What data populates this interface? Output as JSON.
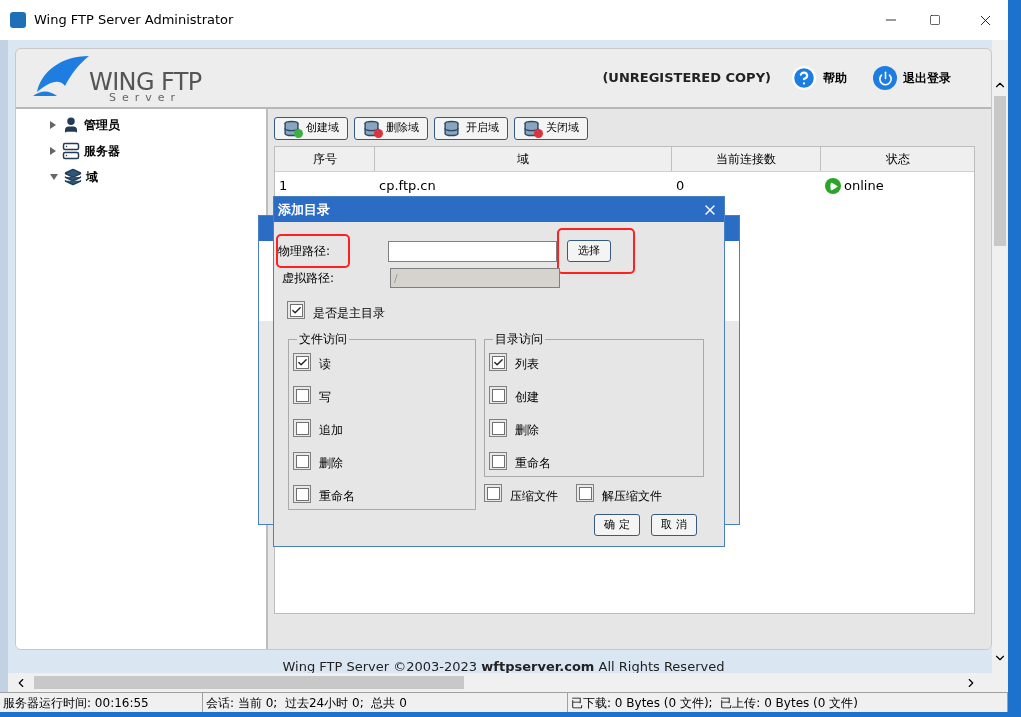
{
  "window": {
    "title": "Wing FTP Server Administrator"
  },
  "header": {
    "logo_text": "WING FTP",
    "logo_subtext": "Server",
    "registration": "(UNREGISTERED COPY)",
    "help": "帮助",
    "logout": "退出登录"
  },
  "tree": [
    {
      "label": "管理员",
      "kind": "admin",
      "expanded": false
    },
    {
      "label": "服务器",
      "kind": "server",
      "expanded": false
    },
    {
      "label": "域",
      "kind": "domain",
      "expanded": true
    }
  ],
  "toolbar": [
    {
      "label": "创建域",
      "kind": "create"
    },
    {
      "label": "删除域",
      "kind": "delete"
    },
    {
      "label": "开启域",
      "kind": "start"
    },
    {
      "label": "关闭域",
      "kind": "stop"
    }
  ],
  "table": {
    "columns": [
      "序号",
      "域",
      "当前连接数",
      "状态"
    ],
    "rows": [
      {
        "cells": [
          "1",
          "cp.ftp.cn",
          "0"
        ],
        "status": "online"
      }
    ]
  },
  "dialog": {
    "title": "添加目录",
    "physical_path": {
      "label": "物理路径:",
      "highlighted": true
    },
    "virtual_path": {
      "label": "虚拟路径:",
      "value": "/",
      "disabled": true
    },
    "choose_button": {
      "label": "选择",
      "highlighted": true
    },
    "home_dir": {
      "label": "是否是主目录",
      "checked": true
    },
    "file_access": {
      "title": "文件访问",
      "items": [
        {
          "label": "读",
          "checked": true
        },
        {
          "label": "写",
          "checked": false
        },
        {
          "label": "追加",
          "checked": false
        },
        {
          "label": "删除",
          "checked": false
        },
        {
          "label": "重命名",
          "checked": false
        }
      ]
    },
    "dir_access": {
      "title": "目录访问",
      "items": [
        {
          "label": "列表",
          "checked": true
        },
        {
          "label": "创建",
          "checked": false
        },
        {
          "label": "删除",
          "checked": false
        },
        {
          "label": "重命名",
          "checked": false
        }
      ]
    },
    "extras": [
      {
        "label": "压缩文件",
        "checked": false
      },
      {
        "label": "解压缩文件",
        "checked": false
      }
    ],
    "buttons": [
      "确 定",
      "取 消"
    ]
  },
  "footer": "Wing FTP Server ©2003-2023 **wftpserver.com** All Rights Reserved",
  "status_bar": [
    "服务器运行时间: 00:16:55",
    "会话: 当前 0;  过去24小时 0;  总共 0",
    "已下载: 0 Bytes (0 文件);  已上传: 0 Bytes (0 文件)"
  ]
}
